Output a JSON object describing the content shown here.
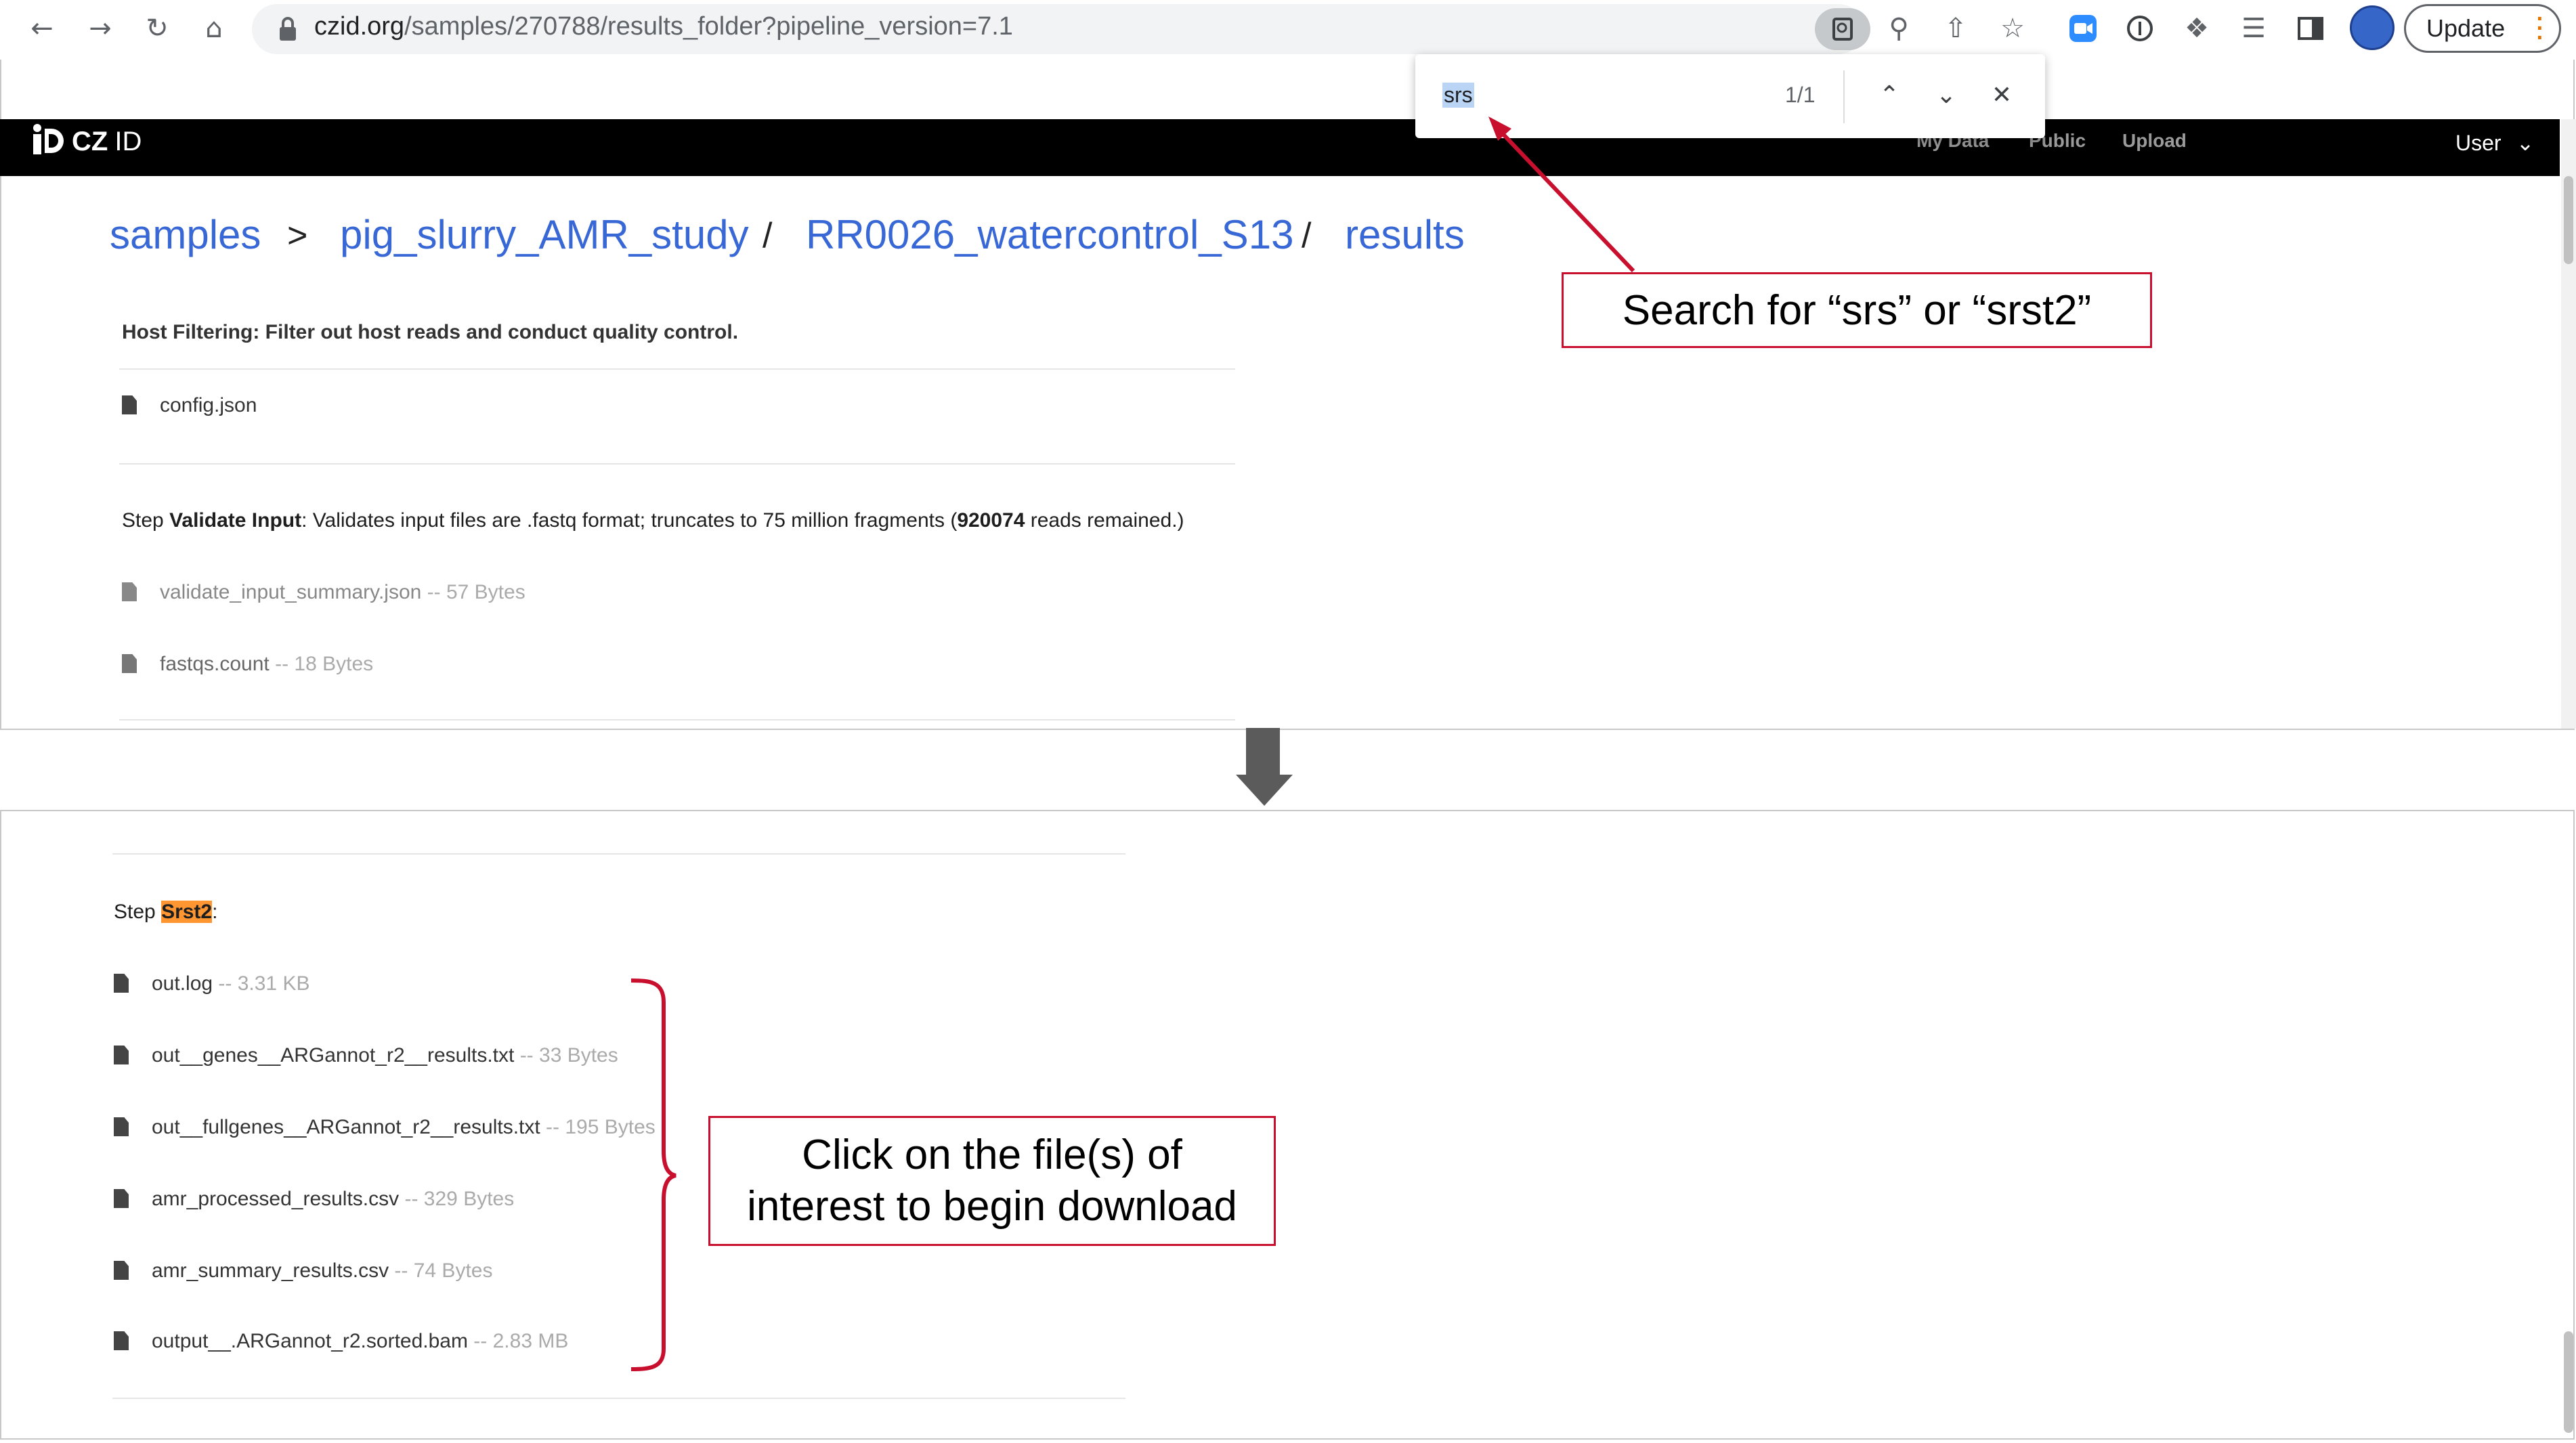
{
  "browser": {
    "url_host": "czid.org",
    "url_path": "/samples/270788/results_folder?pipeline_version=7.1",
    "update_label": "Update"
  },
  "find_bar": {
    "query": "srs",
    "count": "1/1"
  },
  "app": {
    "logo_text": "CZ",
    "logo_id": "ID",
    "nav": [
      "My Data",
      "Public",
      "Upload"
    ],
    "user_label": "User"
  },
  "breadcrumb": {
    "items": [
      "samples",
      "pig_slurry_AMR_study",
      "RR0026_watercontrol_S13",
      "results"
    ],
    "separators": [
      ">",
      "/",
      "/"
    ]
  },
  "top_section": {
    "host_filtering": "Host Filtering: Filter out host reads and conduct quality control.",
    "config_file": "config.json",
    "validate_step_prefix": "Step ",
    "validate_step_name": "Validate Input",
    "validate_step_mid": ": Validates input files are .fastq format; truncates to 75 million fragments (",
    "validate_step_reads": "920074",
    "validate_step_suffix": " reads remained.)",
    "files": [
      {
        "name": "validate_input_summary.json",
        "size": " -- 57 Bytes"
      },
      {
        "name": "fastqs.count",
        "size": " -- 18 Bytes"
      }
    ]
  },
  "bottom_section": {
    "step_prefix": "Step ",
    "step_name": "Srst2",
    "step_suffix": ":",
    "files": [
      {
        "name": "out.log",
        "size": " -- 3.31 KB"
      },
      {
        "name": "out__genes__ARGannot_r2__results.txt",
        "size": " -- 33 Bytes"
      },
      {
        "name": "out__fullgenes__ARGannot_r2__results.txt",
        "size": " -- 195 Bytes"
      },
      {
        "name": "amr_processed_results.csv",
        "size": " -- 329 Bytes"
      },
      {
        "name": "amr_summary_results.csv",
        "size": " -- 74 Bytes"
      },
      {
        "name": "output__.ARGannot_r2.sorted.bam",
        "size": " -- 2.83 MB"
      }
    ]
  },
  "annotations": {
    "search_callout": "Search for “srs” or “srst2”",
    "click_callout_line1": "Click on the file(s) of",
    "click_callout_line2": "interest to begin download",
    "callout_color": "#c8102e"
  }
}
